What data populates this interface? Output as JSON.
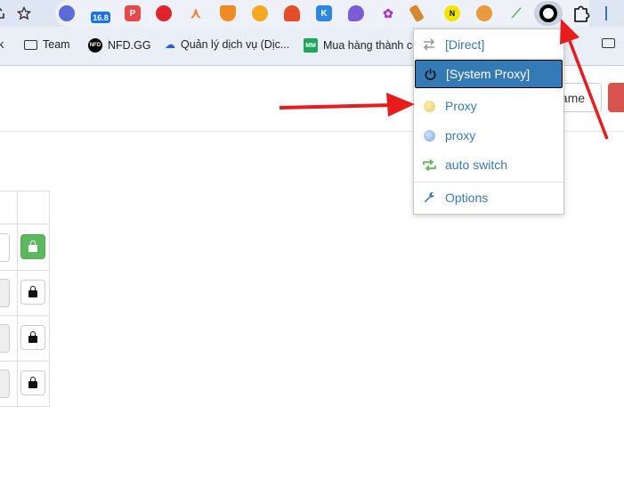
{
  "toolbar": {
    "extensions": [
      {
        "name": "ext-1",
        "color": "#5b6bd8",
        "badge": ""
      },
      {
        "name": "ext-2",
        "color": "#1a73e8",
        "badge": "16.8"
      },
      {
        "name": "ext-3",
        "color": "#e8474c",
        "badge": "P"
      },
      {
        "name": "ext-4",
        "color": "#e0242c",
        "badge": ""
      },
      {
        "name": "ext-5",
        "color": "#f47a3a",
        "badge": ""
      },
      {
        "name": "ext-6",
        "color": "#f08a24",
        "badge": ""
      },
      {
        "name": "ext-7",
        "color": "#f5a623",
        "badge": ""
      },
      {
        "name": "ext-8",
        "color": "#e44d26",
        "badge": ""
      },
      {
        "name": "ext-9",
        "color": "#2b87e0",
        "badge": "K"
      },
      {
        "name": "ext-10",
        "color": "#7c5cd6",
        "badge": ""
      },
      {
        "name": "ext-11",
        "color": "#b03ac8",
        "badge": ""
      },
      {
        "name": "ext-12",
        "color": "#d48a2c",
        "badge": ""
      },
      {
        "name": "ext-13",
        "color": "#111111",
        "badge": ""
      },
      {
        "name": "ext-14",
        "color": "#e89a3c",
        "badge": ""
      },
      {
        "name": "ext-15",
        "color": "#4caf50",
        "badge": ""
      }
    ]
  },
  "bookmarks": {
    "items": [
      {
        "label": "k"
      },
      {
        "label": "Team"
      },
      {
        "label": "NFD.GG"
      },
      {
        "label": "Quản lý dịch vụ (Dịc..."
      },
      {
        "label": "Mua hàng thành cô"
      }
    ]
  },
  "page": {
    "name_button": "name"
  },
  "popup": {
    "items": [
      {
        "label": "[Direct]"
      },
      {
        "label": "[System Proxy]"
      },
      {
        "label": "Proxy"
      },
      {
        "label": "proxy"
      },
      {
        "label": "auto switch"
      },
      {
        "label": "Options"
      }
    ],
    "colors": {
      "accent": "#337ab7",
      "proxy_globe": "#f0d97a",
      "proxy2_globe": "#8fb7e6",
      "auto_switch": "#5cb85c"
    }
  }
}
